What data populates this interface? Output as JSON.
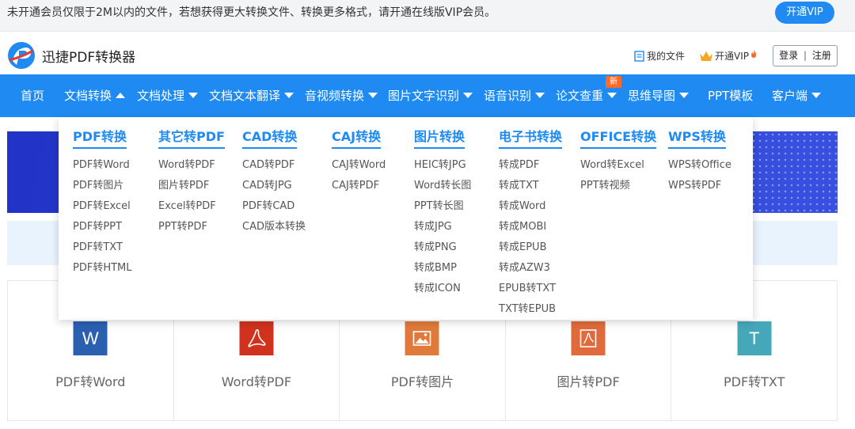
{
  "notice": {
    "text": "未开通会员仅限于2M以内的文件，若想获得更大转换文件、转换更多格式，请开通在线版VIP会员。",
    "button": "开通VIP"
  },
  "header": {
    "app_name": "迅捷PDF转换器",
    "my_files": "我的文件",
    "vip": "开通VIP",
    "login": "登录",
    "divider": "|",
    "register": "注册"
  },
  "nav": {
    "items": [
      {
        "label": "首页"
      },
      {
        "label": "文档转换"
      },
      {
        "label": "文档处理"
      },
      {
        "label": "文档文本翻译"
      },
      {
        "label": "音视频转换"
      },
      {
        "label": "图片文字识别"
      },
      {
        "label": "语音识别"
      },
      {
        "label": "论文查重"
      },
      {
        "label": "思维导图"
      },
      {
        "label": "PPT模板"
      },
      {
        "label": "客户端"
      }
    ],
    "new_badge": "新"
  },
  "dropdown": {
    "columns": [
      {
        "title": "PDF转换",
        "links": [
          "PDF转Word",
          "PDF转图片",
          "PDF转Excel",
          "PDF转PPT",
          "PDF转TXT",
          "PDF转HTML"
        ]
      },
      {
        "title": "其它转PDF",
        "links": [
          "Word转PDF",
          "图片转PDF",
          "Excel转PDF",
          "PPT转PDF"
        ]
      },
      {
        "title": "CAD转换",
        "links": [
          "CAD转PDF",
          "CAD转JPG",
          "PDF转CAD",
          "CAD版本转换"
        ]
      },
      {
        "title": "CAJ转换",
        "links": [
          "CAJ转Word",
          "CAJ转PDF"
        ]
      },
      {
        "title": "图片转换",
        "links": [
          "HEIC转JPG",
          "Word转长图",
          "PPT转长图",
          "转成JPG",
          "转成PNG",
          "转成BMP",
          "转成ICON"
        ]
      },
      {
        "title": "电子书转换",
        "links": [
          "转成PDF",
          "转成TXT",
          "转成Word",
          "转成MOBI",
          "转成EPUB",
          "转成AZW3",
          "EPUB转TXT",
          "TXT转EPUB"
        ]
      },
      {
        "title": "OFFICE转换",
        "links": [
          "Word转Excel",
          "PPT转视频"
        ]
      },
      {
        "title": "WPS转换",
        "links": [
          "WPS转Office",
          "WPS转PDF"
        ]
      }
    ]
  },
  "cards": [
    {
      "label": "PDF转Word",
      "icon": "word-icon",
      "glyph": "W",
      "color": "#2b5fb0"
    },
    {
      "label": "Word转PDF",
      "icon": "pdf-icon",
      "glyph": "",
      "color": "#d0321e"
    },
    {
      "label": "PDF转图片",
      "icon": "image-icon",
      "glyph": "",
      "color": "#e07a3c"
    },
    {
      "label": "图片转PDF",
      "icon": "pdf-icon",
      "glyph": "",
      "color": "#e06a3c"
    },
    {
      "label": "PDF转TXT",
      "icon": "txt-icon",
      "glyph": "T",
      "color": "#45a8b8"
    }
  ],
  "colors": {
    "accent": "#1f8bf2",
    "badge": "#ff6a28"
  }
}
